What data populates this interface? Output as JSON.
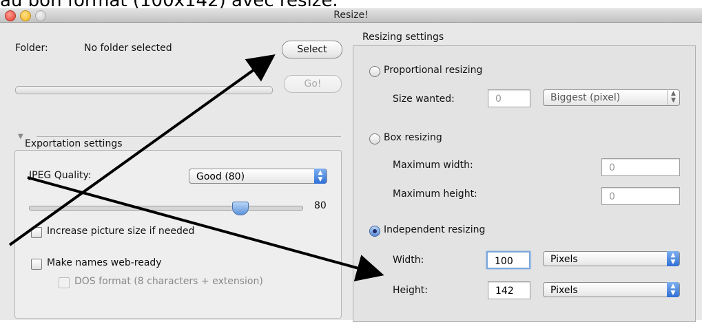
{
  "caption": "au bon format (100x142) avec resize.",
  "window": {
    "title": "Resize!"
  },
  "left": {
    "folder_label": "Folder:",
    "folder_value": "No folder selected",
    "select_button": "Select",
    "go_button": "Go!",
    "export": {
      "title": "Exportation settings",
      "jpeg_label": "JPEG Quality:",
      "jpeg_value": "Good (80)",
      "quality_number": "80",
      "quality_value": 80,
      "increase_label": "Increase picture size if needed",
      "webready_label": "Make names web-ready",
      "dos_label": "DOS format (8 characters + extension)"
    }
  },
  "right": {
    "title": "Resizing settings",
    "proportional": {
      "label": "Proportional resizing",
      "size_label": "Size wanted:",
      "size_value": "0",
      "mode": "Biggest (pixel)"
    },
    "box": {
      "label": "Box resizing",
      "max_width_label": "Maximum width:",
      "max_width_value": "0",
      "max_height_label": "Maximum height:",
      "max_height_value": "0"
    },
    "independent": {
      "label": "Independent resizing",
      "width_label": "Width:",
      "width_value": "100",
      "width_unit": "Pixels",
      "height_label": "Height:",
      "height_value": "142",
      "height_unit": "Pixels"
    }
  },
  "colors": {
    "accent": "#2f6ed6",
    "arrow": "#000000"
  }
}
